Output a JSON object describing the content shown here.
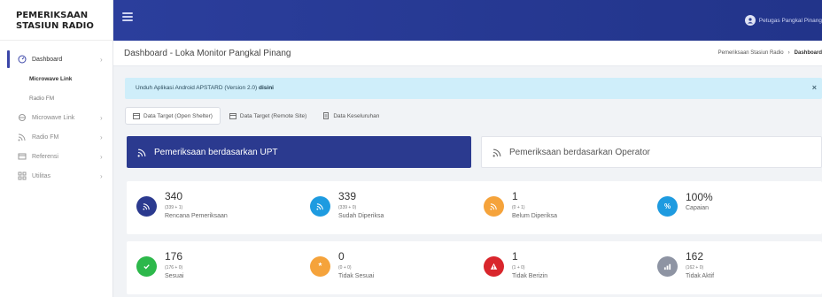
{
  "brand": {
    "line1": "PEMERIKSAAN",
    "line2": "STASIUN RADIO"
  },
  "sidebar": {
    "items": [
      {
        "label": "Dashboard",
        "icon": "dashboard-icon",
        "active": true
      },
      {
        "label": "Microwave Link",
        "icon": "link-icon"
      },
      {
        "label": "Radio FM",
        "icon": "signal-icon"
      },
      {
        "label": "Referensi",
        "icon": "reference-icon"
      },
      {
        "label": "Utilitas",
        "icon": "grid-icon"
      }
    ],
    "sub_items": [
      {
        "label": "Microwave Link"
      },
      {
        "label": "Radio FM"
      }
    ]
  },
  "topbar": {
    "user_name": "Petugas Pangkal Pinang"
  },
  "page": {
    "title": "Dashboard - Loka Monitor Pangkal Pinang",
    "breadcrumb": [
      "Pemeriksaan Stasiun Radio",
      "Dashboard"
    ]
  },
  "alert": {
    "text": "Unduh Aplikasi Android APSTARD (Version 2.0)",
    "link": "disini",
    "close": "×"
  },
  "tabs": [
    {
      "label": "Data Target (Open Shelter)",
      "active": true
    },
    {
      "label": "Data Target (Remote Site)"
    },
    {
      "label": "Data Keseluruhan"
    }
  ],
  "buttons": {
    "upt": "Pemeriksaan berdasarkan UPT",
    "operator": "Pemeriksaan berdasarkan Operator"
  },
  "stats_row1": [
    {
      "value": "340",
      "sub": "(339 + 1)",
      "label": "Rencana Pemeriksaan",
      "color": "#2b3a8f",
      "icon": "signal-icon"
    },
    {
      "value": "339",
      "sub": "(339 + 0)",
      "label": "Sudah Diperiksa",
      "color": "#1e9be0",
      "icon": "signal-icon"
    },
    {
      "value": "1",
      "sub": "(0 + 1)",
      "label": "Belum Diperiksa",
      "color": "#f5a33b",
      "icon": "signal-icon"
    },
    {
      "value": "100%",
      "sub": "",
      "label": "Capaian",
      "color": "#1e9be0",
      "icon": "percent-icon"
    }
  ],
  "stats_row2": [
    {
      "value": "176",
      "sub": "(176 + 0)",
      "label": "Sesuai",
      "color": "#2db84b",
      "icon": "check-icon"
    },
    {
      "value": "0",
      "sub": "(0 + 0)",
      "label": "Tidak Sesuai",
      "color": "#f5a33b",
      "icon": "asterisk-icon"
    },
    {
      "value": "1",
      "sub": "(1 + 0)",
      "label": "Tidak Berizin",
      "color": "#d9262c",
      "icon": "warning-icon"
    },
    {
      "value": "162",
      "sub": "(162 + 0)",
      "label": "Tidak Aktif",
      "color": "#8e94a3",
      "icon": "bars-icon"
    }
  ]
}
